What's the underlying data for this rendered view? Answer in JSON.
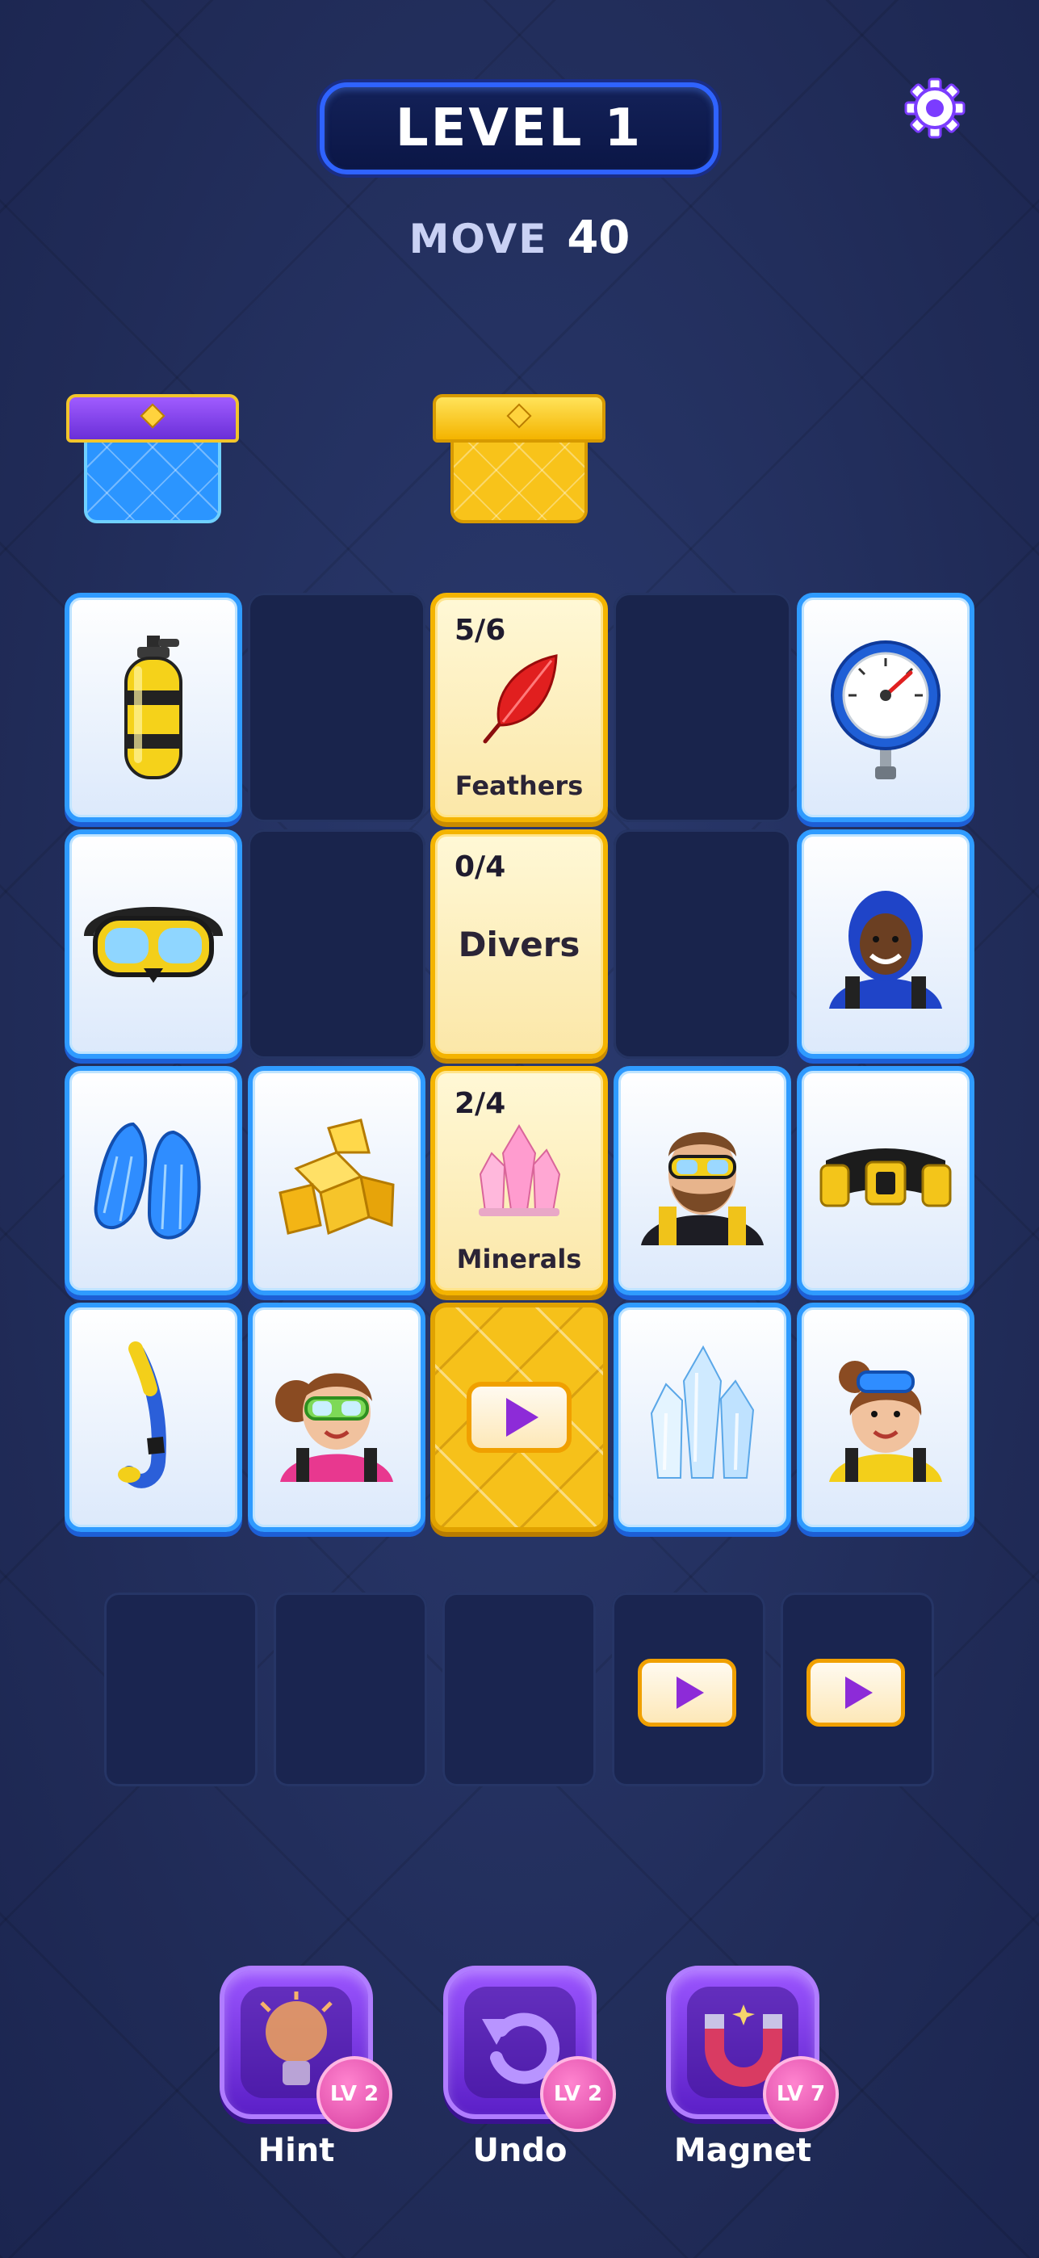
{
  "header": {
    "level_label": "LEVEL 1",
    "moves_label": "MOVE",
    "moves_value": "40"
  },
  "settings": {
    "icon": "gear-icon"
  },
  "boxes": [
    {
      "name": "purple-blue-box",
      "color": "#2b95ff"
    },
    {
      "name": "gold-box",
      "color": "#f8c31a"
    }
  ],
  "grid": [
    [
      {
        "type": "item",
        "icon": "scuba-tank"
      },
      {
        "type": "empty"
      },
      {
        "type": "goal",
        "count": "5/6",
        "label": "Feathers",
        "icon": "red-feather"
      },
      {
        "type": "empty"
      },
      {
        "type": "item",
        "icon": "pressure-gauge"
      }
    ],
    [
      {
        "type": "item",
        "icon": "diving-mask"
      },
      {
        "type": "empty"
      },
      {
        "type": "goal",
        "count": "0/4",
        "label": "Divers",
        "icon": ""
      },
      {
        "type": "empty"
      },
      {
        "type": "item",
        "icon": "diver-blue-suit"
      }
    ],
    [
      {
        "type": "item",
        "icon": "swim-fins"
      },
      {
        "type": "item",
        "icon": "gold-nuggets"
      },
      {
        "type": "goal",
        "count": "2/4",
        "label": "Minerals",
        "icon": "pink-crystal"
      },
      {
        "type": "item",
        "icon": "diver-bearded"
      },
      {
        "type": "item",
        "icon": "weight-belt"
      }
    ],
    [
      {
        "type": "item",
        "icon": "snorkel"
      },
      {
        "type": "item",
        "icon": "diver-girl-green-mask"
      },
      {
        "type": "locked",
        "icon": "play-icon"
      },
      {
        "type": "item",
        "icon": "ice-crystal"
      },
      {
        "type": "item",
        "icon": "diver-girl-blue-mask"
      }
    ]
  ],
  "tray": [
    {
      "state": "empty"
    },
    {
      "state": "empty"
    },
    {
      "state": "empty"
    },
    {
      "state": "locked",
      "icon": "play-icon"
    },
    {
      "state": "locked",
      "icon": "play-icon"
    }
  ],
  "boosters": [
    {
      "label": "Hint",
      "level": "LV 2",
      "icon": "lightbulb-icon"
    },
    {
      "label": "Undo",
      "level": "LV 2",
      "icon": "undo-icon"
    },
    {
      "label": "Magnet",
      "level": "LV 7",
      "icon": "magnet-icon"
    }
  ],
  "colors": {
    "accent_blue": "#2f9bff",
    "gold": "#f4b400",
    "purple": "#8d2bd8",
    "badge_pink": "#d63d9f"
  }
}
